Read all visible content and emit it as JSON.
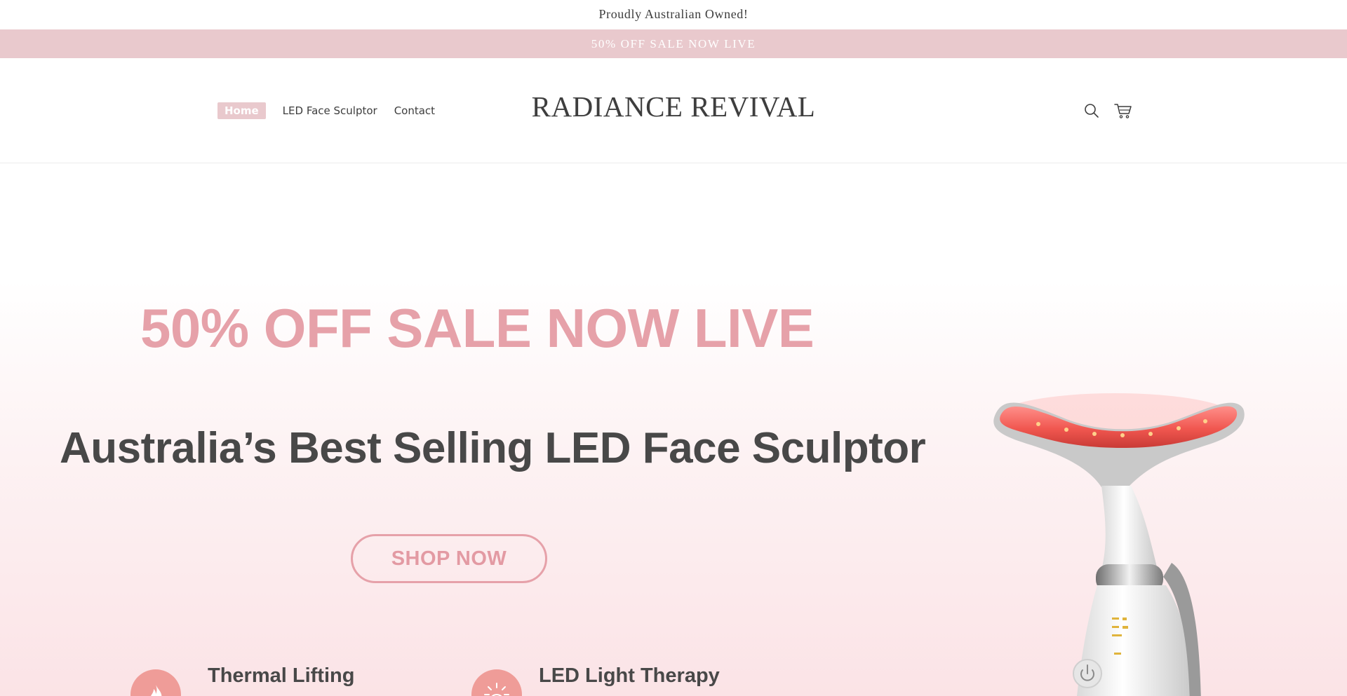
{
  "announcement": {
    "text": "Proudly Australian Owned!"
  },
  "promo_bar": {
    "text": "50% OFF SALE NOW LIVE"
  },
  "header": {
    "brand": "RADIANCE REVIVAL",
    "nav": [
      {
        "label": "Home",
        "active": true
      },
      {
        "label": "LED Face Sculptor",
        "active": false
      },
      {
        "label": "Contact",
        "active": false
      }
    ],
    "icons": [
      "search-icon",
      "cart-icon"
    ]
  },
  "hero": {
    "sale_heading": "50% OFF SALE NOW LIVE",
    "headline": "Australia’s Best Selling LED Face Sculptor",
    "cta_label": "SHOP NOW",
    "features": [
      {
        "title": "Thermal Lifting",
        "icon": "flame-icon"
      },
      {
        "title": "LED Light Therapy",
        "icon": "sun-icon"
      }
    ]
  },
  "colors": {
    "accent_pink": "#e6a1a9",
    "promo_bg": "#e9c9cd",
    "text_dark": "#484848",
    "feature_icon_bg": "#ef9c98"
  }
}
